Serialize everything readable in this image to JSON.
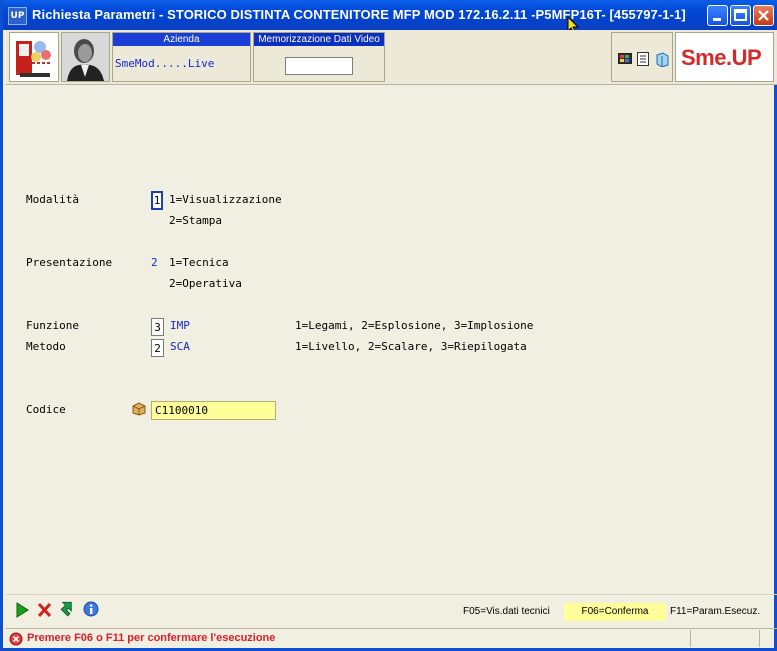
{
  "window": {
    "title": "Richiesta Parametri -  STORICO DISTINTA CONTENITORE MFP MOD 172.16.2.11 -P5MFP16T- [455797-1-1]",
    "app_icon_text": "UP"
  },
  "toolbar": {
    "azienda_label": "Azienda",
    "azienda_value": "SmeMod.....Live",
    "memo_label": "Memorizzazione Dati Video",
    "memo_value": "",
    "brand": "Sme.UP"
  },
  "form": {
    "modalita": {
      "label": "Modalità",
      "value": "1",
      "options": [
        "1=Visualizzazione",
        "2=Stampa"
      ]
    },
    "presentazione": {
      "label": "Presentazione",
      "value": "2",
      "options": [
        "1=Tecnica",
        "2=Operativa"
      ]
    },
    "funzione": {
      "label": "Funzione",
      "value": "3",
      "code": "IMP",
      "help": "1=Legami, 2=Esplosione, 3=Implosione"
    },
    "metodo": {
      "label": "Metodo",
      "value": "2",
      "code": "SCA",
      "help": "1=Livello, 2=Scalare, 3=Riepilogata"
    },
    "codice": {
      "label": "Codice",
      "value": "C1100010"
    }
  },
  "function_keys": {
    "f05": "F05=Vis.dati tecnici",
    "f06": "F06=Conferma",
    "f11": "F11=Param.Esecuz."
  },
  "status": {
    "message": "Premere F06 o F11 per confermare l'esecuzione"
  },
  "colors": {
    "title_bar": "#0a4fdc",
    "field_label_blue": "#1428c8",
    "highlight_yellow": "#ffff99",
    "status_red": "#d8202a"
  }
}
